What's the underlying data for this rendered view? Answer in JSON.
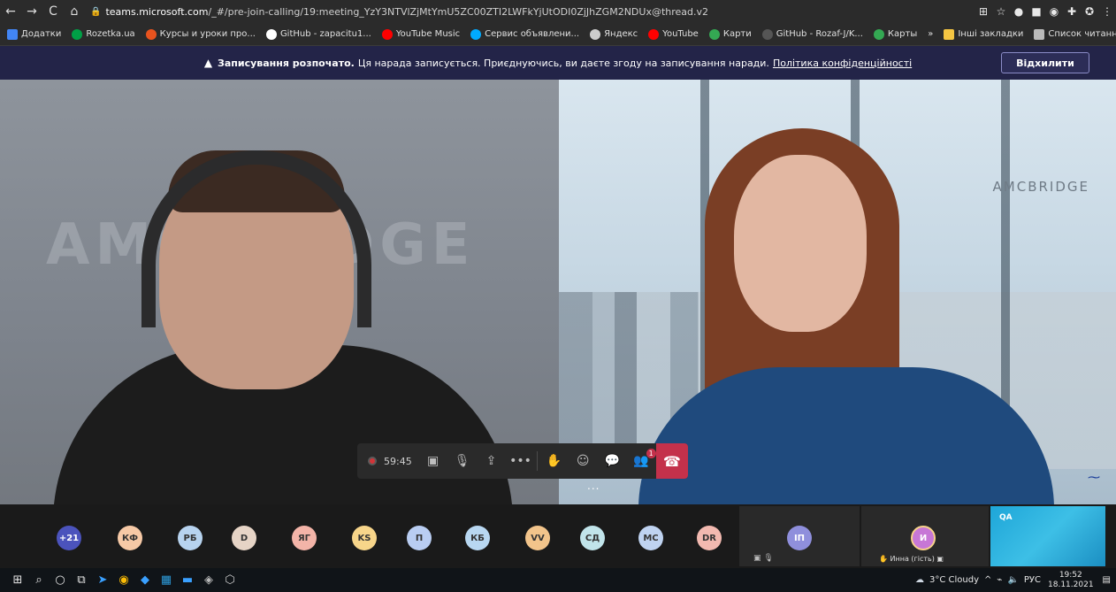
{
  "browser": {
    "nav": {
      "back_icon": "←",
      "forward_icon": "→",
      "reload_icon": "C",
      "home_icon": "⌂"
    },
    "url_host": "teams.microsoft.com",
    "url_path": "/_#/pre-join-calling/19:meeting_YzY3NTVlZjMtYmU5ZC00ZTI2LWFkYjUtODI0ZjJhZGM2NDUx@thread.v2",
    "extensions": [
      "⊞",
      "☆",
      "●",
      "■",
      "◉",
      "✚",
      "✪",
      "⋮"
    ],
    "bookmarks": [
      {
        "label": "Додатки",
        "color": "#4285f4"
      },
      {
        "label": "Rozetka.ua",
        "color": "#00a046"
      },
      {
        "label": "Курсы и уроки про...",
        "color": "#e8531e"
      },
      {
        "label": "GitHub - zapacitu1...",
        "color": "#ffffff"
      },
      {
        "label": "YouTube Music",
        "color": "#ff0000"
      },
      {
        "label": "Сервис объявлени...",
        "color": "#00aaff"
      },
      {
        "label": "Яндекс",
        "color": "#cccccc"
      },
      {
        "label": "YouTube",
        "color": "#ff0000"
      },
      {
        "label": "Карти",
        "color": "#34a853"
      },
      {
        "label": "GitHub - Rozaf-J/K...",
        "color": "#333333"
      },
      {
        "label": "Карты",
        "color": "#34a853"
      }
    ],
    "bookmarks_more": "»",
    "other_bookmarks": "Інші закладки",
    "reading_list": "Список читання"
  },
  "banner": {
    "title": "Записування розпочато.",
    "text": "Ця нарада записується. Приєднуючись, ви даєте згоду на записування наради.",
    "policy_link": "Політика конфіденційності",
    "dismiss_label": "Відхилити"
  },
  "video": {
    "left_logo": "AMCBRIDGE",
    "right_logo": "AMCBRIDGE"
  },
  "controls": {
    "timer": "59:45",
    "participants_badge": "1",
    "more_dots": "..."
  },
  "participants": {
    "overflow": "+21",
    "avatars": [
      {
        "initials": "КФ",
        "color": "#f6c9a6"
      },
      {
        "initials": "РБ",
        "color": "#b7d3ef"
      },
      {
        "initials": "D",
        "color": "#e6d4c6"
      },
      {
        "initials": "ЯГ",
        "color": "#f3b4a8"
      },
      {
        "initials": "KS",
        "color": "#f7d58a"
      },
      {
        "initials": "П",
        "color": "#b9cdf2"
      },
      {
        "initials": "КБ",
        "color": "#b8d7f1"
      },
      {
        "initials": "VV",
        "color": "#f2c48b"
      },
      {
        "initials": "СД",
        "color": "#c1e4ea"
      },
      {
        "initials": "МС",
        "color": "#bfd3f1"
      },
      {
        "initials": "DR",
        "color": "#f2b9b0"
      }
    ],
    "tile1_initials": "ІП",
    "tile2_initials": "И",
    "tile2_name": "Инна (гість)",
    "qa_label": "QA"
  },
  "taskbar": {
    "weather": "3°C  Cloudy",
    "lang": "РУС",
    "time": "19:52",
    "date": "18.11.2021"
  }
}
